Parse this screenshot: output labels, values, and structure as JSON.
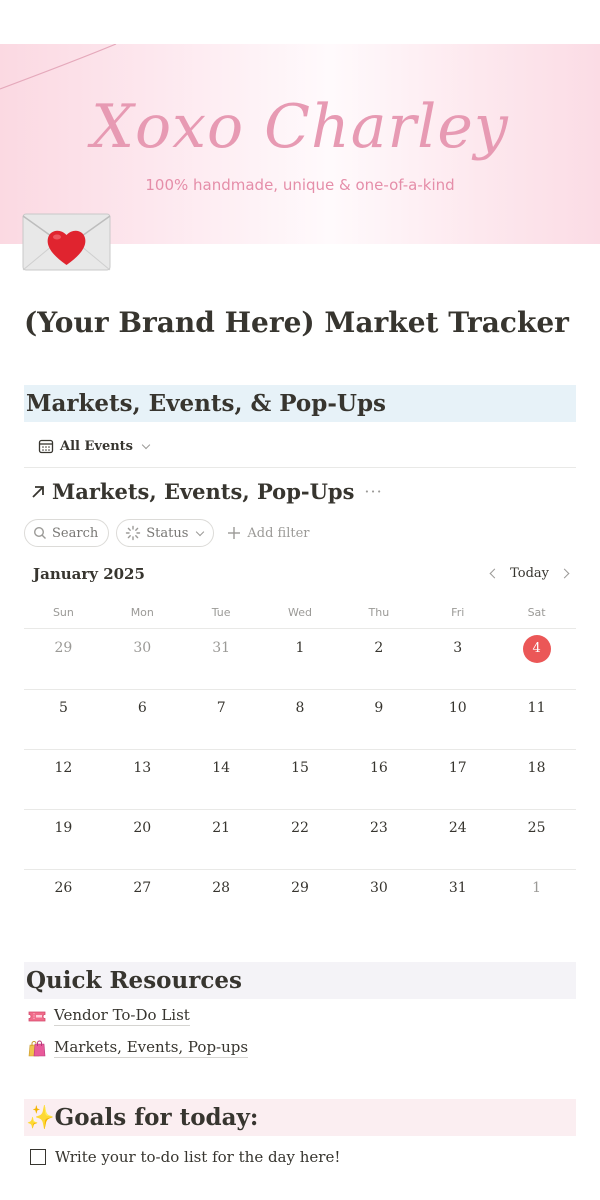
{
  "cover": {
    "title": "Xoxo Charley",
    "tagline": "100% handmade, unique & one-of-a-kind"
  },
  "page": {
    "icon": "love-letter-icon",
    "title": "(Your Brand Here) Market Tracker"
  },
  "section_markets": {
    "heading": "Markets, Events, & Pop-Ups"
  },
  "database": {
    "view_tab": "All Events",
    "title": "Markets, Events, Pop-Ups",
    "more_label": "···",
    "filters": {
      "search_label": "Search",
      "status_label": "Status",
      "add_filter_label": "Add filter"
    }
  },
  "calendar": {
    "month_label": "January 2025",
    "today_label": "Today",
    "weekdays": [
      "Sun",
      "Mon",
      "Tue",
      "Wed",
      "Thu",
      "Fri",
      "Sat"
    ],
    "weeks": [
      [
        "29",
        "30",
        "31",
        "1",
        "2",
        "3",
        "4"
      ],
      [
        "5",
        "6",
        "7",
        "8",
        "9",
        "10",
        "11"
      ],
      [
        "12",
        "13",
        "14",
        "15",
        "16",
        "17",
        "18"
      ],
      [
        "19",
        "20",
        "21",
        "22",
        "23",
        "24",
        "25"
      ],
      [
        "26",
        "27",
        "28",
        "29",
        "30",
        "31",
        "1"
      ]
    ],
    "colors": {
      "today": "#eb5757",
      "muted": "#9b9a97"
    }
  },
  "quick_resources": {
    "heading": "Quick Resources",
    "items": [
      {
        "icon": "ticket-icon",
        "label": "Vendor To-Do List"
      },
      {
        "icon": "shopping-bags-icon",
        "label": "Markets, Events, Pop-ups"
      }
    ]
  },
  "goals": {
    "heading": "✨Goals for today:",
    "todo_text": "Write your to-do list for the day here!"
  },
  "colors": {
    "blue_heading_bg": "#e7f2f8",
    "grey_heading_bg": "#f4f3f7",
    "pink_heading_bg": "#fbeef1",
    "cover_pink": "#e79ab3"
  }
}
